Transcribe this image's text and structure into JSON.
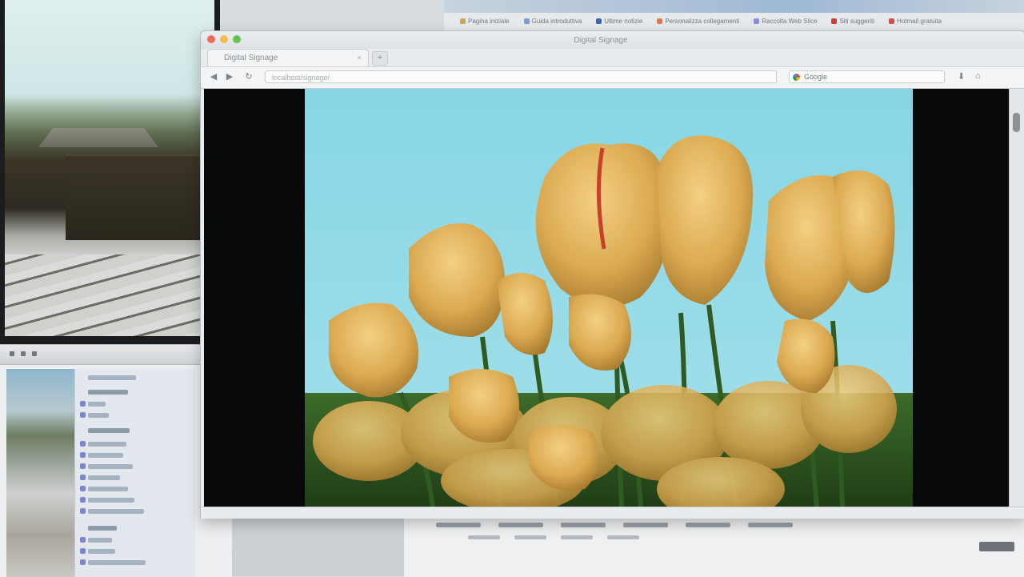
{
  "background_windows": {
    "bookmarks": [
      {
        "label": "Pagina iniziale",
        "color": "#c9a94b"
      },
      {
        "label": "Guida introduttiva",
        "color": "#7a9fd1"
      },
      {
        "label": "Ultime notizie",
        "color": "#3b66b3"
      },
      {
        "label": "Personalizza collegamenti",
        "color": "#e07c4b"
      },
      {
        "label": "Raccolta Web Slice",
        "color": "#8a8fd0"
      },
      {
        "label": "Siti suggeriti",
        "color": "#cf3a3a"
      },
      {
        "label": "Hotmail gratuita",
        "color": "#d84b4b"
      }
    ]
  },
  "browser": {
    "window_title": "Digital Signage",
    "tab_label": "Digital Signage",
    "tab_close": "×",
    "new_tab": "+",
    "nav": {
      "back": "◀",
      "forward": "▶",
      "reload": "↻",
      "home": "⌂",
      "download": "⬇"
    },
    "url": "localhost/signage/",
    "search_placeholder": "Google",
    "icons": {
      "back": "back-arrow-icon",
      "forward": "forward-arrow-icon",
      "reload": "reload-icon",
      "search_engine": "google-icon",
      "download": "download-icon",
      "home": "home-icon"
    }
  },
  "colors": {
    "sky": "#7fd2e4",
    "petal": "#e2b25a",
    "stem": "#2f5a22",
    "letterbox": "#070808"
  }
}
